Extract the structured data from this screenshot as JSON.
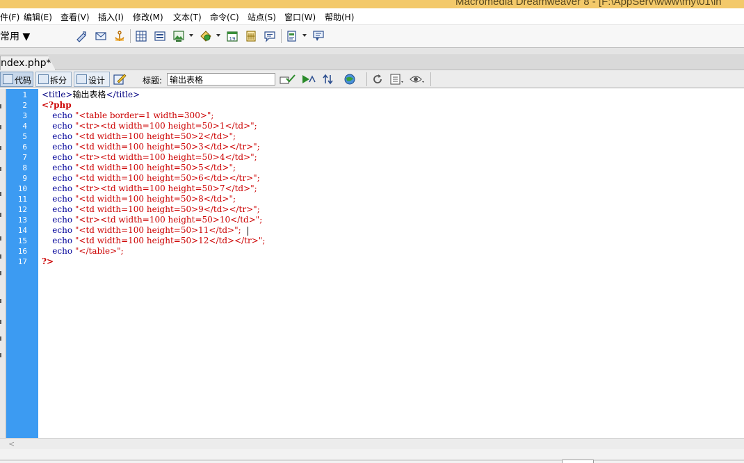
{
  "window": {
    "title": "Macromedia Dreamweaver 8 - [F:\\AppServ\\www\\my\\01\\in"
  },
  "menu": [
    "件(F)",
    "编辑(E)",
    "查看(V)",
    "插入(I)",
    "修改(M)",
    "文本(T)",
    "命令(C)",
    "站点(S)",
    "窗口(W)",
    "帮助(H)"
  ],
  "insert_bar": {
    "category": "常用 ▼",
    "icons": [
      "hyperlink-icon",
      "email-link-icon",
      "named-anchor-icon",
      "table-icon",
      "layer-icon",
      "image-icon",
      "media-icon",
      "date-icon",
      "comment-icon",
      "templates-icon",
      "tag-chooser-icon"
    ]
  },
  "document": {
    "tab_label": "ndex.php*",
    "views": {
      "code": "代码",
      "split": "拆分",
      "design": "设计"
    },
    "title_label": "标题:",
    "title_value": "输出表格"
  },
  "code": {
    "line_numbers": [
      "1",
      "2",
      "3",
      "4",
      "5",
      "6",
      "7",
      "8",
      "9",
      "10",
      "11",
      "12",
      "13",
      "14",
      "15",
      "16",
      "17"
    ],
    "lines": [
      "<title>输出表格</title>",
      "<?php",
      "    echo \"<table border=1 width=300>\";",
      "    echo \"<tr><td width=100 height=50>1</td>\";",
      "    echo \"<td width=100 height=50>2</td>\";",
      "    echo \"<td width=100 height=50>3</td></tr>\";",
      "    echo \"<tr><td width=100 height=50>4</td>\";",
      "    echo \"<td width=100 height=50>5</td>\";",
      "    echo \"<td width=100 height=50>6</td></tr>\";",
      "    echo \"<tr><td width=100 height=50>7</td>\";",
      "    echo \"<td width=100 height=50>8</td>\";",
      "    echo \"<td width=100 height=50>9</td></tr>\";",
      "    echo \"<tr><td width=100 height=50>10</td>\";",
      "    echo \"<td width=100 height=50>11</td>\";",
      "    echo \"<td width=100 height=50>12</td></tr>\";",
      "    echo \"</table>\";",
      "?>"
    ],
    "caret_line": 14
  },
  "colors": {
    "gutter": "#3c9bf2",
    "php_delimiter": "#cc0000",
    "string": "#cc0000",
    "keyword": "#000099",
    "html_tag": "#000080"
  }
}
